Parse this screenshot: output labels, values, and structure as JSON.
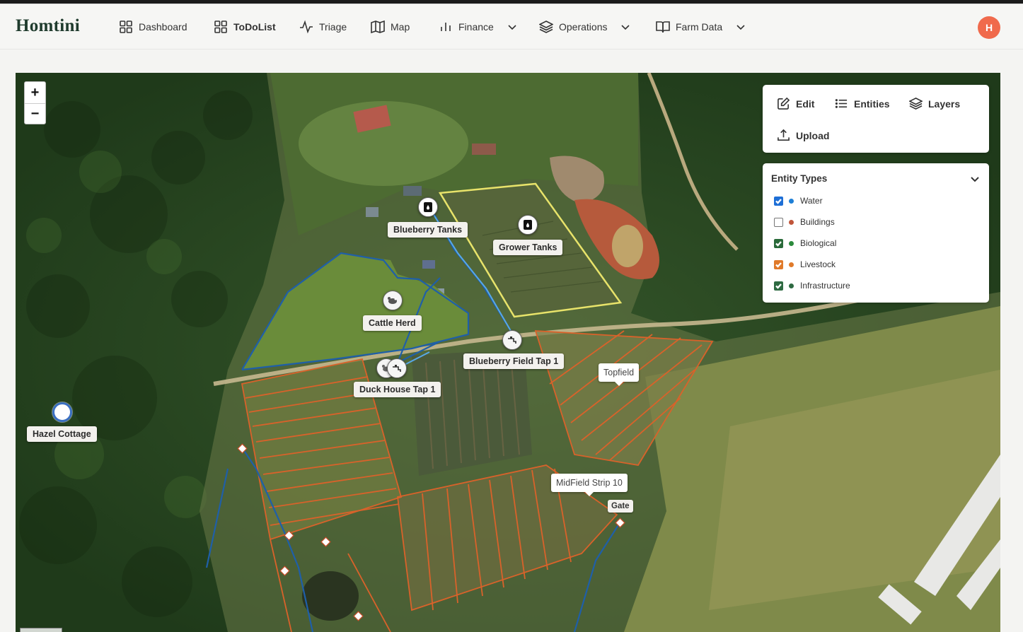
{
  "app": {
    "brand": "Homtini",
    "user_initial": "H",
    "avatar_color": "#f06a4c"
  },
  "nav": {
    "dashboard": "Dashboard",
    "todolist": "ToDoList",
    "triage": "Triage",
    "map": "Map",
    "finance": "Finance",
    "operations": "Operations",
    "farm_data": "Farm Data"
  },
  "map": {
    "zoom_in": "+",
    "zoom_out": "−",
    "markers": {
      "blueberry_tanks": "Blueberry Tanks",
      "grower_tanks": "Grower Tanks",
      "cattle_herd": "Cattle Herd",
      "blueberry_field_tap": "Blueberry Field Tap 1",
      "duck_house_tap": "Duck House Tap 1",
      "hazel_cottage": "Hazel Cottage"
    },
    "tooltips": {
      "topfield": "Topfield",
      "midfield": "MidField Strip 10",
      "gate": "Gate"
    },
    "colors": {
      "field_lines": "#d9622a",
      "water_lines": "#1f5fa8",
      "boundary": "#e8e36a"
    }
  },
  "tools": {
    "edit": "Edit",
    "entities": "Entities",
    "layers": "Layers",
    "upload": "Upload"
  },
  "entity_types": {
    "title": "Entity Types",
    "items": [
      {
        "label": "Water",
        "checked": true,
        "dot": "#1e7fd6",
        "box": "#1e6fd6"
      },
      {
        "label": "Buildings",
        "checked": false,
        "dot": "#c0553a",
        "box": ""
      },
      {
        "label": "Biological",
        "checked": true,
        "dot": "#2c8a3c",
        "box": "#2a6a3a"
      },
      {
        "label": "Livestock",
        "checked": true,
        "dot": "#e07a2a",
        "box": "#e07a2a"
      },
      {
        "label": "Infrastructure",
        "checked": true,
        "dot": "#2e6a42",
        "box": "#2e6a42"
      }
    ]
  }
}
